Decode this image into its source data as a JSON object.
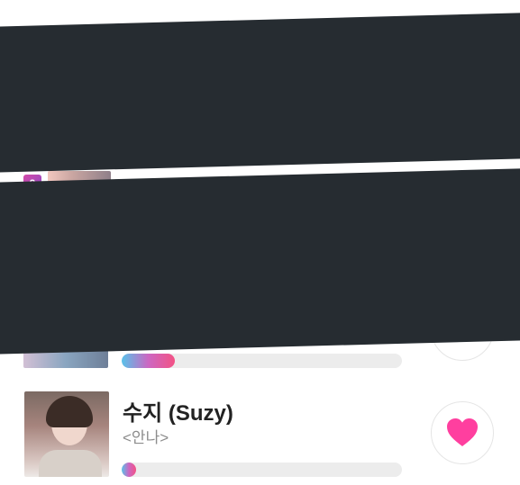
{
  "rows": [
    {
      "rank": "2",
      "title": "",
      "subtitle": "",
      "progress": 0
    },
    {
      "rank": "",
      "title": "",
      "subtitle": "",
      "progress": 0.19
    },
    {
      "rank": "",
      "title": "수지 (Suzy)",
      "subtitle": "<안나>",
      "progress": 0.05,
      "vote_icon": "heart-icon",
      "vote_color": "#ff3f9f"
    }
  ],
  "colors": {
    "redaction": "#262c31",
    "progress_gradient": [
      "#58c2ea",
      "#cc67c2",
      "#f35285"
    ],
    "track": "#ececec",
    "rank_badge": "#d44ba8"
  }
}
